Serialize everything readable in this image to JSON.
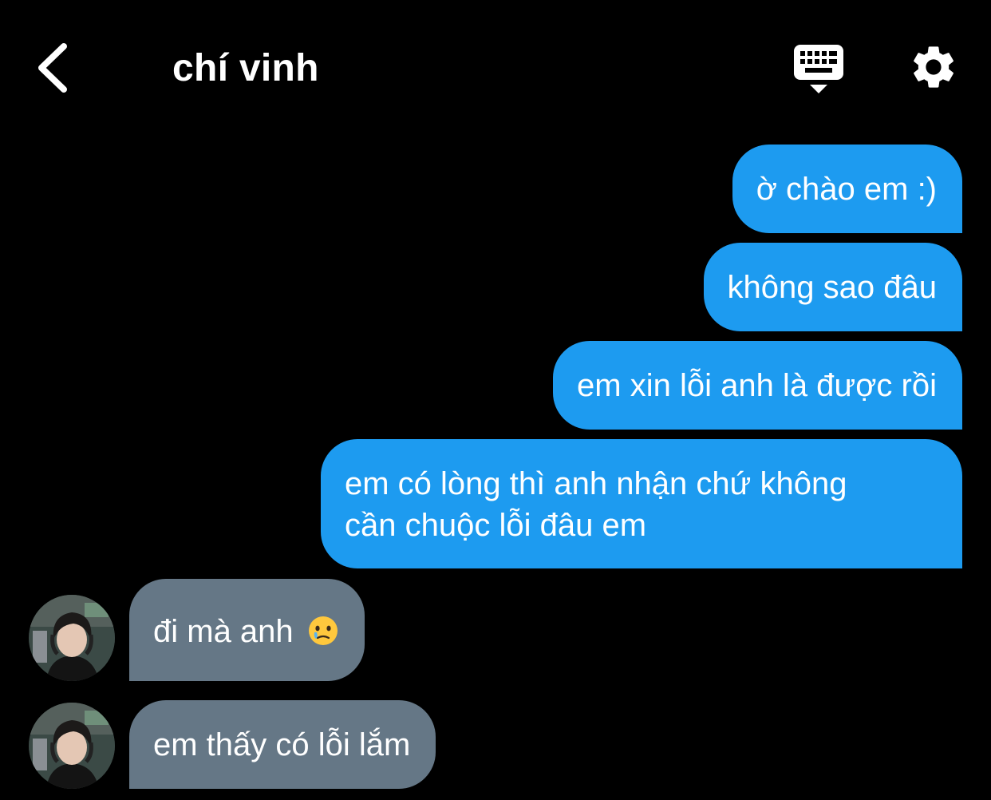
{
  "header": {
    "title": "chí vinh",
    "back_icon": "chevron-left-icon",
    "keyboard_icon": "keyboard-hide-icon",
    "settings_icon": "gear-icon"
  },
  "colors": {
    "background": "#000000",
    "outgoing_bubble": "#1D9BF0",
    "incoming_bubble": "#657786",
    "text": "#FFFFFF"
  },
  "messages": [
    {
      "direction": "outgoing",
      "text": "ờ chào em :)"
    },
    {
      "direction": "outgoing",
      "text": "không sao đâu"
    },
    {
      "direction": "outgoing",
      "text": "em xin lỗi anh là được rồi"
    },
    {
      "direction": "outgoing",
      "lines": [
        "em có lòng thì anh nhận chứ không",
        "cần chuộc lỗi đâu em"
      ]
    },
    {
      "direction": "incoming",
      "text": "đi mà anh",
      "emoji": "face-holding-back-tears"
    },
    {
      "direction": "incoming",
      "text": "em thấy có lỗi lắm"
    }
  ]
}
